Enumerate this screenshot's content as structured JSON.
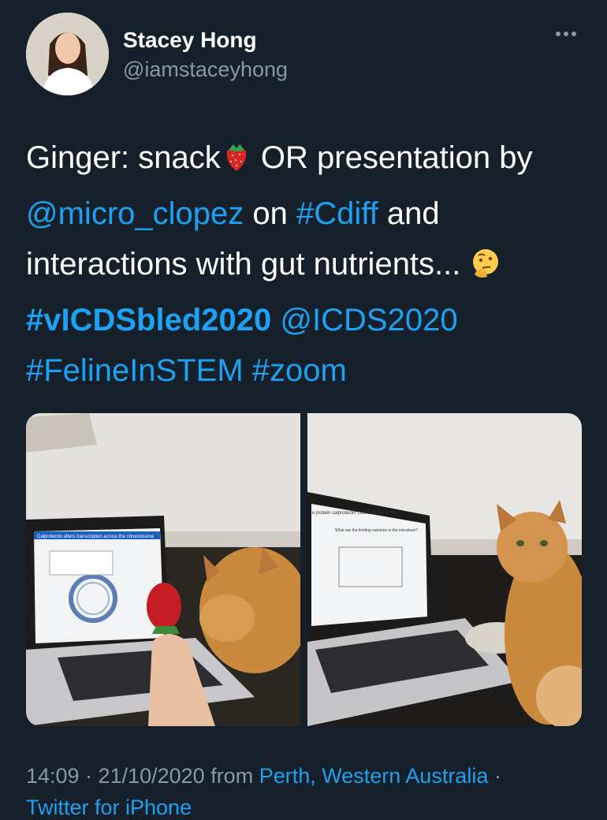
{
  "user": {
    "display_name": "Stacey Hong",
    "handle": "@iamstaceyhong"
  },
  "tweet": {
    "line1_text": "Ginger: snack",
    "line1_text2": " OR presentation by",
    "mention1": "@micro_clopez",
    "on": " on ",
    "hashtag1": "#Cdiff",
    "and": " and",
    "line3": "interactions with gut nutrients... ",
    "hashtag2": "#vICDSbled2020",
    "space": " ",
    "mention2": "@ICDS2020",
    "hashtag3": "#FelineInSTEM",
    "hashtag4": "#zoom",
    "emoji1": "strawberry-emoji",
    "emoji2": "thinking-face-emoji"
  },
  "photos": {
    "left": {
      "slide_title": "Calprotectin alters transcription across the chromosome"
    },
    "right": {
      "slide_title": "e protein calprotectin (S100A8/A9) limits",
      "slide_subtitle": "What are the limiting nutrients in the intestines?"
    }
  },
  "meta": {
    "time_date": "14:09 · 21/10/2020 from ",
    "location": "Perth, Western Australia",
    "sep": " ·",
    "source": "Twitter for iPhone"
  },
  "colors": {
    "background": "#15202b",
    "link": "#1da1f2",
    "secondary": "#8899a6"
  }
}
